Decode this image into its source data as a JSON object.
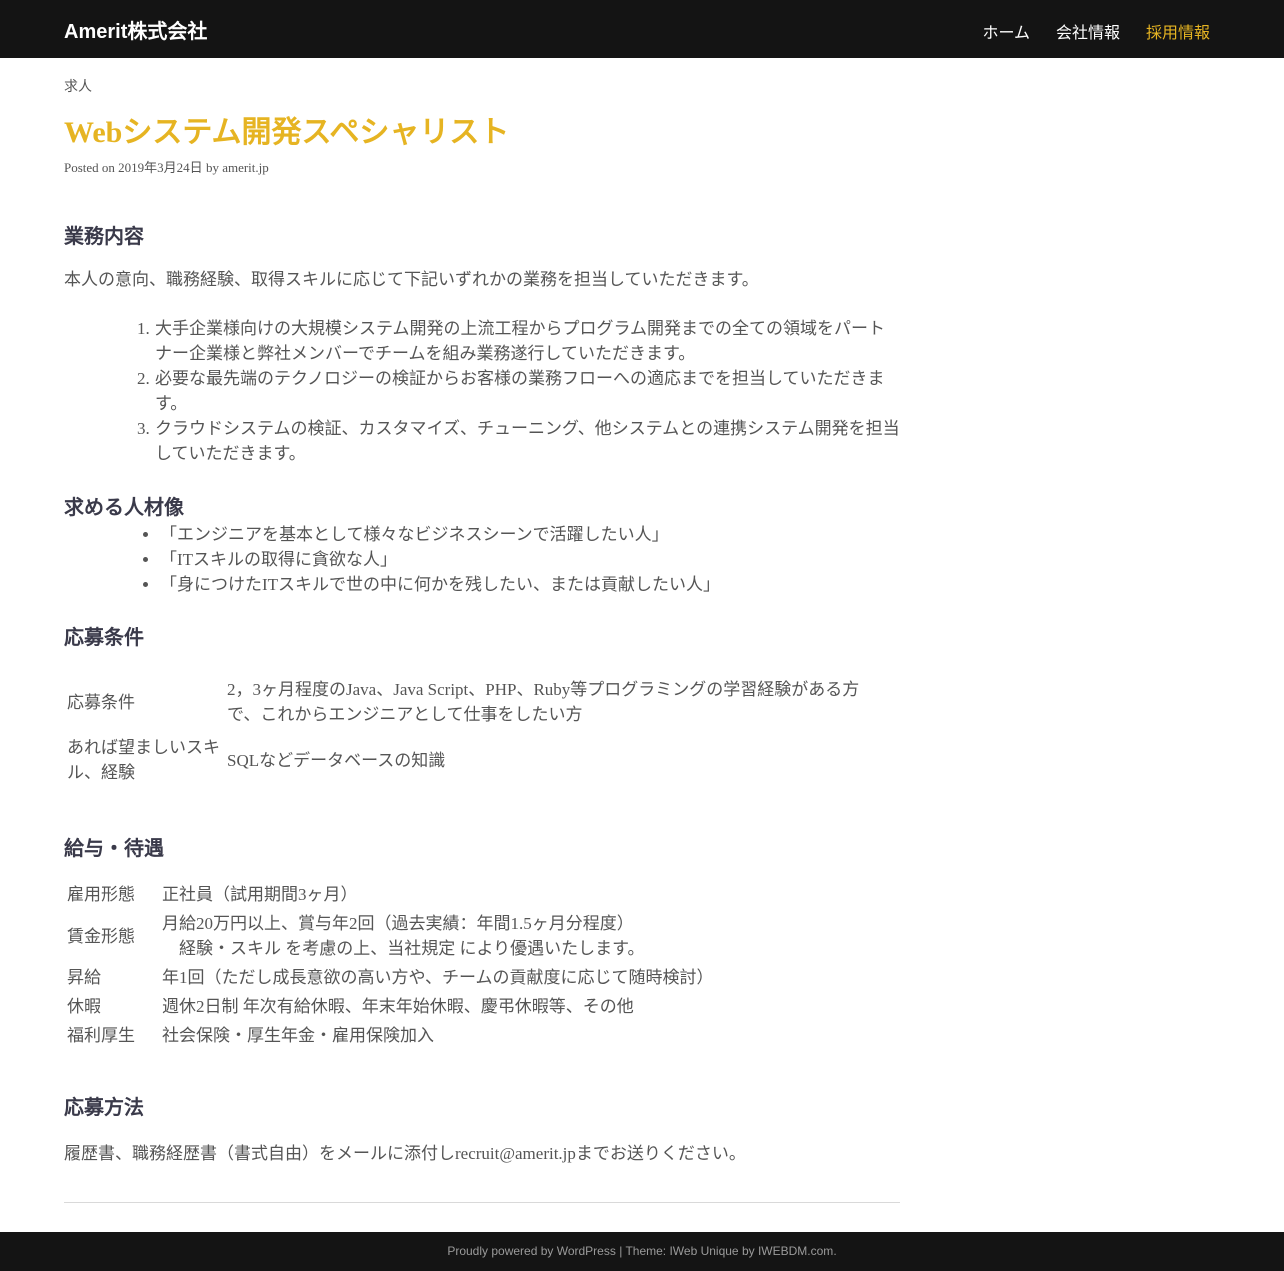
{
  "header": {
    "site_title": "Amerit株式会社",
    "nav": [
      {
        "label": "ホーム"
      },
      {
        "label": "会社情報"
      },
      {
        "label": "採用情報"
      }
    ]
  },
  "post": {
    "category": "求人",
    "title": "Webシステム開発スペシャリスト",
    "meta": {
      "posted_on": "Posted on",
      "date": "2019年3月24日",
      "by": "by",
      "author": "amerit.jp"
    }
  },
  "sections": {
    "duties": {
      "heading": "業務内容",
      "intro": "本人の意向、職務経験、取得スキルに応じて下記いずれかの業務を担当していただきます。",
      "items": [
        "大手企業様向けの大規模システム開発の上流工程からプログラム開発までの全ての領域をパートナー企業様と弊社メンバーでチームを組み業務遂行していただきます。",
        "必要な最先端のテクノロジーの検証からお客様の業務フローへの適応までを担当していただきます。",
        "クラウドシステムの検証、カスタマイズ、チューニング、他システムとの連携システム開発を担当していただきます。"
      ]
    },
    "persona": {
      "heading": "求める人材像",
      "items": [
        "「エンジニアを基本として様々なビジネスシーンで活躍したい人」",
        "「ITスキルの取得に貪欲な人」",
        "「身につけたITスキルで世の中に何かを残したい、または貢献したい人」"
      ]
    },
    "requirements": {
      "heading": "応募条件",
      "rows": [
        {
          "key": "応募条件",
          "value": "2，3ヶ月程度のJava、Java Script、PHP、Ruby等プログラミングの学習経験がある方で、これからエンジニアとして仕事をしたい方"
        },
        {
          "key": "あれば望ましいスキル、経験",
          "value": "SQLなどデータベースの知識"
        }
      ]
    },
    "salary": {
      "heading": "給与・待遇",
      "rows": [
        {
          "key": "雇用形態",
          "value": "正社員（試用期間3ヶ月）"
        },
        {
          "key": "賃金形態",
          "value": "月給20万円以上、賞与年2回（過去実績：年間1.5ヶ月分程度）",
          "value2": "経験・スキル を考慮の上、当社規定 により優遇いたします。"
        },
        {
          "key": "昇給",
          "value": "年1回（ただし成長意欲の高い方や、チームの貢献度に応じて随時検討）"
        },
        {
          "key": "休暇",
          "value": "週休2日制 年次有給休暇、年末年始休暇、慶弔休暇等、その他"
        },
        {
          "key": "福利厚生",
          "value": "社会保険・厚生年金・雇用保険加入"
        }
      ]
    },
    "apply": {
      "heading": "応募方法",
      "text": "履歴書、職務経歴書（書式自由）をメールに添付しrecruit@amerit.jpまでお送りください。"
    }
  },
  "footer": {
    "powered": "Proudly powered by WordPress",
    "sep": " | ",
    "theme": "Theme: IWeb Unique by",
    "theme_author": "IWEBDM.com",
    "dot": "."
  },
  "colors": {
    "accent": "#e6b422",
    "topbar_bg": "#141414",
    "text": "#555555",
    "heading": "#3a3a4a"
  }
}
